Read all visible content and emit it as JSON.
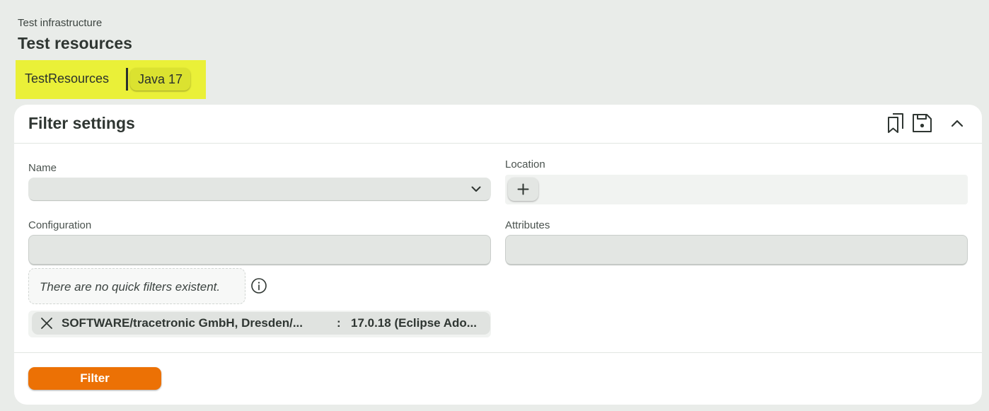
{
  "header": {
    "breadcrumb": "Test infrastructure",
    "title": "Test resources"
  },
  "tagbar": {
    "resource_name": "TestResources",
    "chip_label": "Java 17",
    "highlight_color": "#eaf038"
  },
  "filter_panel": {
    "title": "Filter settings",
    "icons": {
      "bookmark": "bookmarks-icon",
      "save": "save-icon",
      "collapse": "chevron-up-icon"
    },
    "fields": {
      "name_label": "Name",
      "location_label": "Location",
      "configuration_label": "Configuration",
      "attributes_label": "Attributes"
    },
    "quick_filters_text": "There are no quick filters existent.",
    "active_filter": {
      "key": "SOFTWARE/tracetronic GmbH, Dresden/...",
      "separator": ":",
      "value": "17.0.18 (Eclipse Ado..."
    },
    "filter_button": "Filter",
    "accent_color": "#ec7105"
  }
}
